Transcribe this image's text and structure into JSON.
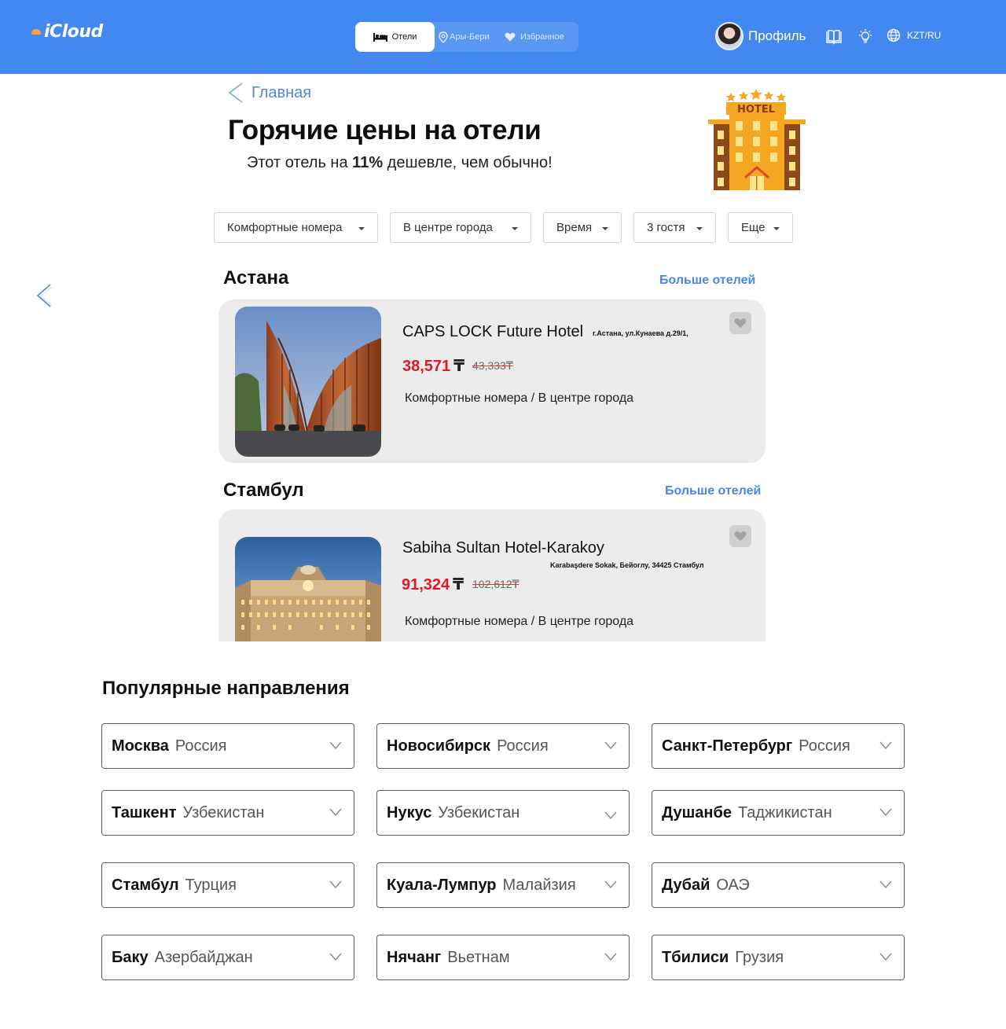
{
  "header": {
    "logo": "Cloud",
    "tabs": [
      {
        "label": "Отели",
        "icon": "bed-icon",
        "active": true
      },
      {
        "label": "Ары-Бери",
        "icon": "location-pin-icon",
        "active": false
      },
      {
        "label": "Избранное",
        "icon": "heart-icon",
        "active": false
      }
    ],
    "profile_label": "Профиль",
    "locale": "KZT/RU"
  },
  "breadcrumb": {
    "back_label": "Главная"
  },
  "hero": {
    "title": "Горячие цены на отели",
    "subtitle_prefix": "Этот отель на ",
    "subtitle_bold": "11%",
    "subtitle_suffix": " дешевле, чем обычно!",
    "illustration_label": "HOTEL"
  },
  "filters": [
    {
      "label": "Комфортные номера"
    },
    {
      "label": "В центре города"
    },
    {
      "label": "Время"
    },
    {
      "label": "3 гостя"
    },
    {
      "label": "Еще"
    }
  ],
  "sections": [
    {
      "city": "Астана",
      "more_label": "Больше отелей",
      "hotel": {
        "name": "CAPS LOCK Future Hotel",
        "address": "г.Астана, ул.Кунаева д.29/1,",
        "price": "38,571",
        "currency": "₸",
        "old_price": "43,333₸",
        "tags": "Комфортные номера / В центре города"
      }
    },
    {
      "city": "Стамбул",
      "more_label": "Больше отелей",
      "hotel": {
        "name": "Sabiha Sultan Hotel-Karakoy",
        "address": "Karabaşdere Sokak, Бейоглу, 34425 Стамбул",
        "price": "91,324",
        "currency": "₸",
        "old_price": "102,612₸",
        "tags": "Комфортные номера / В центре города"
      }
    }
  ],
  "popular": {
    "title": "Популярные направления",
    "destinations": [
      {
        "city": "Москва",
        "country": "Россия"
      },
      {
        "city": "Новосибирск",
        "country": "Россия"
      },
      {
        "city": "Санкт-Петербург",
        "country": "Россия"
      },
      {
        "city": "Ташкент",
        "country": "Узбекистан"
      },
      {
        "city": "Нукус",
        "country": "Узбекистан"
      },
      {
        "city": "Душанбе",
        "country": "Таджикистан"
      },
      {
        "city": "Стамбул",
        "country": "Турция"
      },
      {
        "city": "Куала-Лумпур",
        "country": "Малайзия"
      },
      {
        "city": "Дубай",
        "country": "ОАЭ"
      },
      {
        "city": "Баку",
        "country": "Азербайджан"
      },
      {
        "city": "Нячанг",
        "country": "Вьетнам"
      },
      {
        "city": "Тбилиси",
        "country": "Грузия"
      }
    ]
  },
  "colors": {
    "header_bg": "#4388f0",
    "link": "#4a86e8",
    "price": "#e01a22",
    "card_bg": "#ececec"
  }
}
